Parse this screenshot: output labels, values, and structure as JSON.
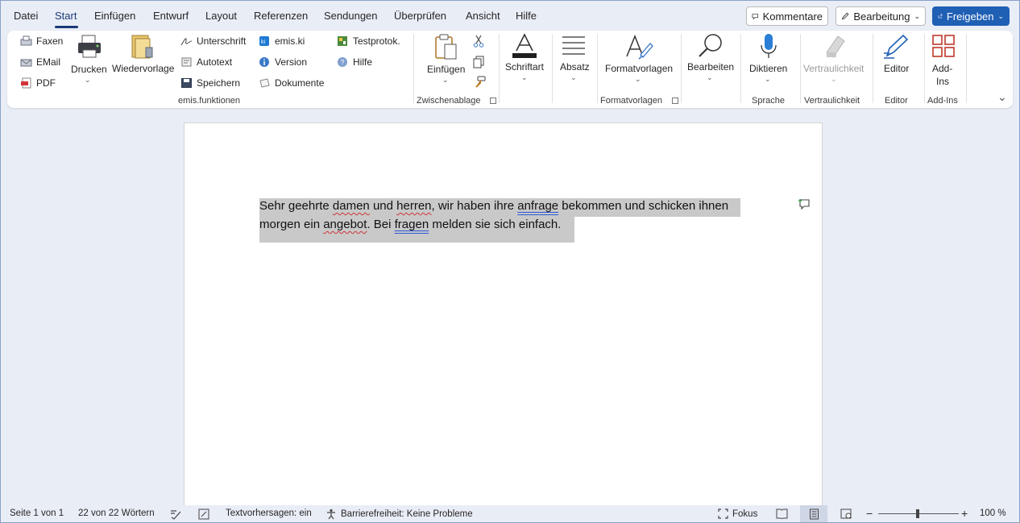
{
  "menu": {
    "tabs": [
      "Datei",
      "Start",
      "Einfügen",
      "Entwurf",
      "Layout",
      "Referenzen",
      "Sendungen",
      "Überprüfen",
      "Ansicht",
      "Hilfe"
    ],
    "active_tab": "Start",
    "comments_label": "Kommentare",
    "editing_label": "Bearbeitung",
    "share_label": "Freigeben"
  },
  "ribbon": {
    "emis": {
      "faxen": "Faxen",
      "email": "EMail",
      "pdf": "PDF",
      "drucken": "Drucken",
      "wiedervorlage": "Wiedervorlage",
      "unterschrift": "Unterschrift",
      "autotext": "Autotext",
      "speichern": "Speichern",
      "emis_ki": "emis.ki",
      "version": "Version",
      "dokumente": "Dokumente",
      "testprotok": "Testprotok.",
      "hilfe": "Hilfe",
      "group_label": "emis.funktionen"
    },
    "clipboard": {
      "paste": "Einfügen",
      "group_label": "Zwischenablage"
    },
    "font": {
      "label": "Schriftart"
    },
    "paragraph": {
      "label": "Absatz"
    },
    "styles": {
      "label": "Formatvorlagen",
      "group_label": "Formatvorlagen"
    },
    "editing": {
      "label": "Bearbeiten"
    },
    "voice": {
      "label": "Diktieren",
      "group_label": "Sprache"
    },
    "sensitivity": {
      "label": "Vertraulichkeit",
      "group_label": "Vertraulichkeit"
    },
    "editor": {
      "label": "Editor",
      "group_label": "Editor"
    },
    "addins": {
      "label_line1": "Add-",
      "label_line2": "Ins",
      "group_label": "Add-Ins"
    }
  },
  "document": {
    "line1_parts": [
      "Sehr geehrte ",
      "damen",
      " und ",
      "herren",
      ", wir haben ihre ",
      "anfrage",
      " bekommen und schicken ihnen"
    ],
    "line2_parts": [
      "morgen ein ",
      "angebot",
      ". Bei ",
      "fragen",
      " melden sie sich einfach."
    ]
  },
  "status": {
    "page": "Seite 1 von 1",
    "words": "22 von 22 Wörtern",
    "predictions": "Textvorhersagen: ein",
    "accessibility": "Barrierefreiheit: Keine Probleme",
    "focus": "Fokus",
    "zoom": "100 %"
  },
  "colors": {
    "accent": "#1f5fb4",
    "selection": "#c9c9c9",
    "background": "#e9edf6"
  }
}
